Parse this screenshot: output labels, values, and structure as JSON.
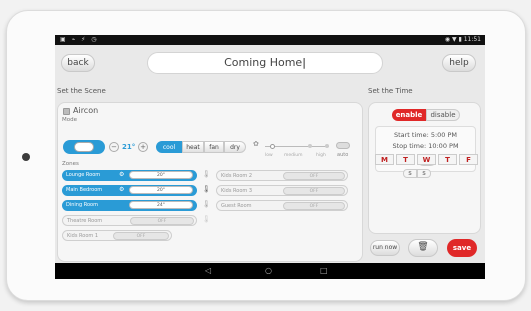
{
  "status_bar": {
    "left": "▣ ⌁ ⚡ ◷",
    "time": "◉ ▼ ▮ 11:51"
  },
  "header": {
    "back": "back",
    "scene_name": "Coming Home",
    "help": "help"
  },
  "scene": {
    "section_label": "Set the Scene",
    "device": "Aircon",
    "mode_label": "Mode",
    "minus": "−",
    "temperature": "21°",
    "plus": "+",
    "modes": [
      "cool",
      "heat",
      "fan",
      "dry"
    ],
    "fan_speeds": [
      "low",
      "medium",
      "high"
    ],
    "fan_auto": "auto",
    "zones_label": "Zones",
    "zones": [
      {
        "name": "Lounge Room",
        "temp": "20°",
        "state": "on"
      },
      {
        "name": "Main Bedroom",
        "temp": "20°",
        "state": "on"
      },
      {
        "name": "Dining Room",
        "temp": "24°",
        "state": "on"
      },
      {
        "name": "Theatre Room",
        "temp": "OFF",
        "state": "off"
      },
      {
        "name": "Kids Room 1",
        "temp": "OFF",
        "state": "off"
      },
      {
        "name": "Kids Room 2",
        "temp": "OFF",
        "state": "off"
      },
      {
        "name": "Kids Room 3",
        "temp": "OFF",
        "state": "off"
      },
      {
        "name": "Guest Room",
        "temp": "OFF",
        "state": "off"
      }
    ]
  },
  "time": {
    "section_label": "Set the Time",
    "enable": "enable",
    "disable": "disable",
    "start": "Start time: 5:00 PM",
    "stop": "Stop time: 10:00 PM",
    "days": [
      "M",
      "T",
      "W",
      "T",
      "F"
    ],
    "weekend": [
      "S",
      "S"
    ]
  },
  "actions": {
    "run_now": "run now",
    "save": "save"
  },
  "navbar": {
    "back": "◁",
    "home": "○",
    "recent": "□"
  },
  "colors": {
    "accent_blue": "#2a9bd6",
    "save_red": "#e02828",
    "day_red": "#c02020"
  }
}
